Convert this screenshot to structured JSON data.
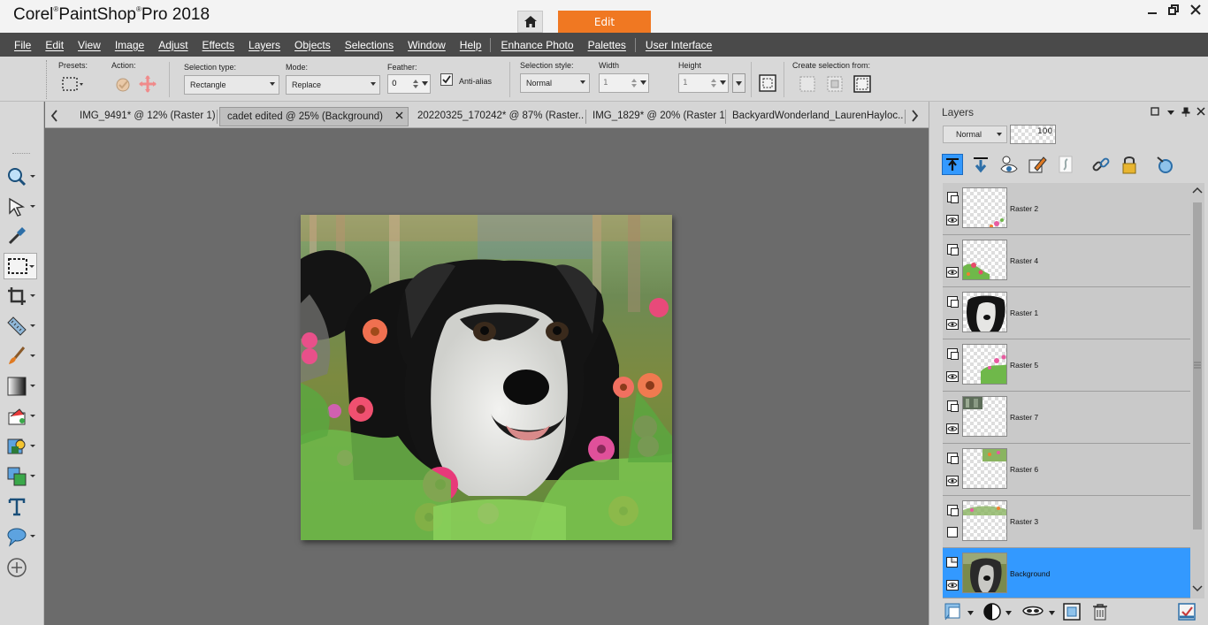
{
  "app": {
    "title_prefix": "Corel",
    "title_main": "PaintShop",
    "title_suffix": "Pro 2018",
    "reg": "®",
    "active_tab": "Edit"
  },
  "menu": [
    "File",
    "Edit",
    "View",
    "Image",
    "Adjust",
    "Effects",
    "Layers",
    "Objects",
    "Selections",
    "Window",
    "Help",
    "Enhance Photo",
    "Palettes",
    "User Interface"
  ],
  "options": {
    "presets_label": "Presets:",
    "action_label": "Action:",
    "selection_type_label": "Selection type:",
    "selection_type_value": "Rectangle",
    "mode_label": "Mode:",
    "mode_value": "Replace",
    "feather_label": "Feather:",
    "feather_value": "0",
    "antialias_label": "Anti-alias",
    "antialias_checked": true,
    "selection_style_label": "Selection style:",
    "selection_style_value": "Normal",
    "width_label": "Width",
    "width_value": "1",
    "height_label": "Height",
    "height_value": "1",
    "create_from_label": "Create selection from:"
  },
  "doc_tabs": [
    {
      "label": "IMG_9491* @  12% (Raster 1)",
      "active": false
    },
    {
      "label": "cadet edited @  25% (Background)",
      "active": true
    },
    {
      "label": "20220325_170242* @  87% (Raster...",
      "active": false
    },
    {
      "label": "IMG_1829* @  20% (Raster 1)",
      "active": false
    },
    {
      "label": "BackyardWonderland_LaurenHayloc...",
      "active": false
    }
  ],
  "layers_panel": {
    "title": "Layers",
    "blend_mode": "Normal",
    "opacity": "100",
    "layers": [
      {
        "name": "Raster 2",
        "visible": true,
        "selected": false
      },
      {
        "name": "Raster 4",
        "visible": true,
        "selected": false
      },
      {
        "name": "Raster 1",
        "visible": true,
        "selected": false
      },
      {
        "name": "Raster 5",
        "visible": true,
        "selected": false
      },
      {
        "name": "Raster 7",
        "visible": true,
        "selected": false
      },
      {
        "name": "Raster 6",
        "visible": true,
        "selected": false
      },
      {
        "name": "Raster 3",
        "visible": false,
        "selected": false
      },
      {
        "name": "Background",
        "visible": true,
        "selected": true
      }
    ]
  },
  "colors": {
    "accent": "#f07822",
    "selection": "#3399ff",
    "menubar": "#4a4a4a",
    "workspace": "#6b6b6b"
  }
}
